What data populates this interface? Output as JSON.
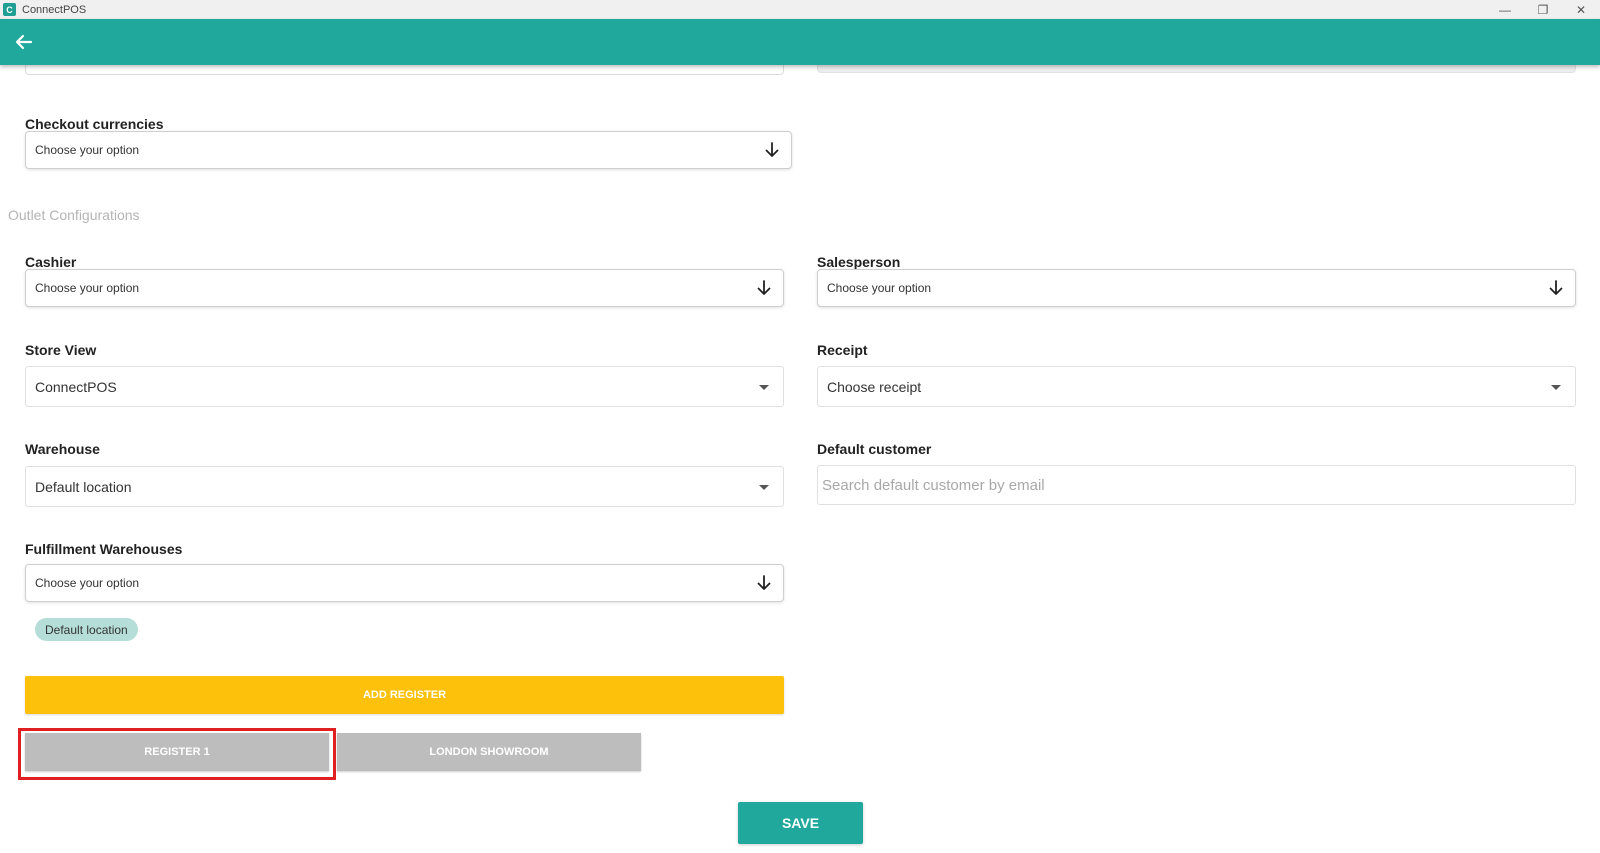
{
  "window": {
    "app_icon_letter": "C",
    "title": "ConnectPOS",
    "minimize_glyph": "—",
    "restore_glyph": "❐",
    "close_glyph": "✕"
  },
  "header": {
    "back_icon": "arrow-left-icon",
    "accent_color": "#21a89d"
  },
  "checkout_currencies": {
    "label": "Checkout currencies",
    "placeholder": "Choose your option"
  },
  "section_title": "Outlet Configurations",
  "cashier": {
    "label": "Cashier",
    "placeholder": "Choose your option"
  },
  "salesperson": {
    "label": "Salesperson",
    "placeholder": "Choose your option"
  },
  "store_view": {
    "label": "Store View",
    "value": "ConnectPOS"
  },
  "receipt": {
    "label": "Receipt",
    "value": "Choose receipt"
  },
  "warehouse": {
    "label": "Warehouse",
    "value": "Default location"
  },
  "default_customer": {
    "label": "Default customer",
    "placeholder": "Search default customer by email"
  },
  "fulfillment_warehouses": {
    "label": "Fulfillment Warehouses",
    "placeholder": "Choose your option",
    "chips": [
      "Default location"
    ]
  },
  "add_register_label": "ADD REGISTER",
  "registers": [
    "REGISTER 1",
    "LONDON SHOWROOM"
  ],
  "save_label": "SAVE",
  "colors": {
    "add_register": "#fdc00b",
    "register_button": "#bdbdbd",
    "highlight": "#e02020"
  }
}
